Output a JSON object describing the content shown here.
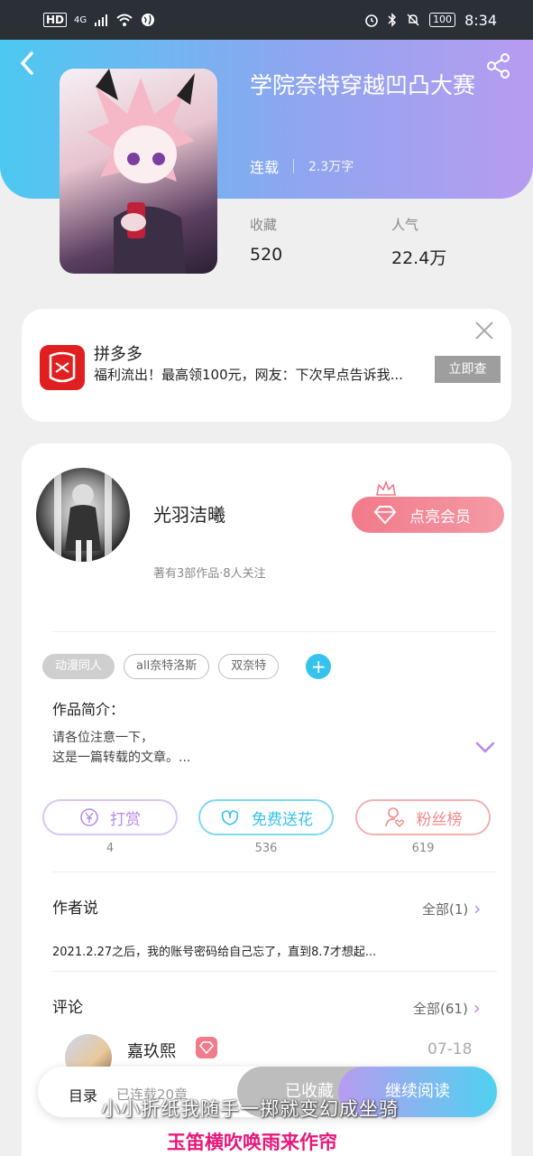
{
  "status_bar": {
    "left_labels": [
      "HD",
      "4G"
    ],
    "battery": "100",
    "time": "8:34"
  },
  "book": {
    "title": "学院奈特穿越凹凸大赛",
    "status": "连载",
    "word_count": "2.3万字",
    "stats": [
      {
        "label": "收藏",
        "value": "520"
      },
      {
        "label": "人气",
        "value": "22.4万"
      }
    ]
  },
  "ad": {
    "brand": "拼多多",
    "description": "福利流出！最高领100元，网友：下次早点告诉我...",
    "button": "立即查"
  },
  "author": {
    "name": "光羽洁曦",
    "meta": "著有3部作品·8人关注",
    "vip_button": "点亮会员"
  },
  "tags": [
    "动漫同人",
    "all奈特洛斯",
    "双奈特"
  ],
  "intro": {
    "heading": "作品简介：",
    "lines": [
      "请各位注意一下，",
      "这是一篇转载的文章。..."
    ]
  },
  "actions": [
    {
      "label": "打赏",
      "count": "4",
      "color": "#b48ae8",
      "icon": "yen-coin-icon"
    },
    {
      "label": "免费送花",
      "count": "536",
      "color": "#37c2ee",
      "icon": "flower-icon"
    },
    {
      "label": "粉丝榜",
      "count": "619",
      "color": "#f08a8a",
      "icon": "fan-user-icon"
    }
  ],
  "author_say": {
    "heading": "作者说",
    "more": "全部(1)",
    "text": "2021.2.27之后，我的账号密码给自己忘了，直到8.7才想起..."
  },
  "comments": {
    "heading": "评论",
    "more": "全部(61)",
    "first": {
      "name": "嘉玖熙",
      "date": "07-18"
    }
  },
  "bottom_bar": {
    "toc": "目录",
    "chapters": "已连载20章",
    "favorited": "已收藏",
    "continue": "继续阅读"
  },
  "subtitles": {
    "line1": "小小折纸我随手一掷就变幻成坐骑",
    "line2": "玉笛横吹唤雨来作帘"
  },
  "colors": {
    "header_start": "#4cc9f0",
    "header_end": "#b79cf0",
    "vip": "#f27a8a",
    "accent_purple": "#b48ae8",
    "accent_blue": "#37c2ee"
  }
}
